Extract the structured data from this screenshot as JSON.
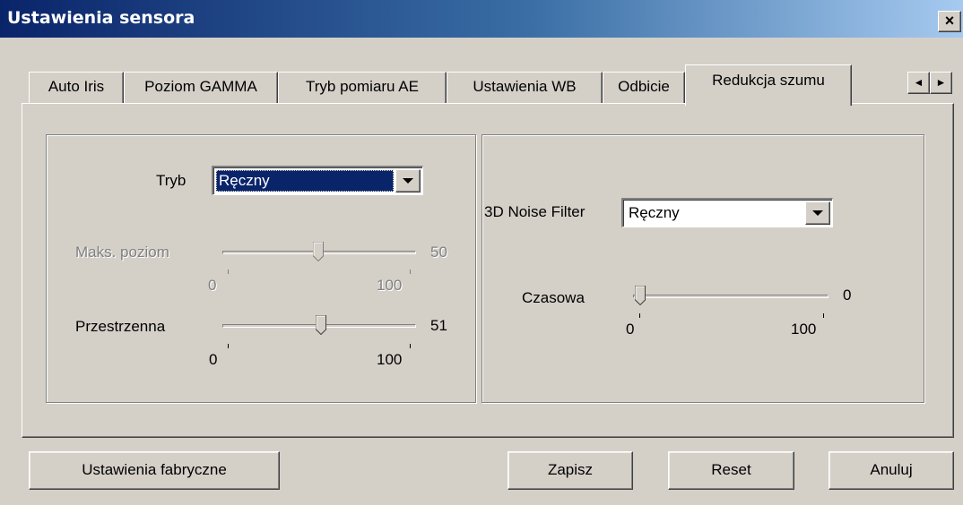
{
  "window": {
    "title": "Ustawienia sensora",
    "close_label": "×"
  },
  "tabs": [
    {
      "label": "Auto Iris"
    },
    {
      "label": "Poziom GAMMA"
    },
    {
      "label": "Tryb pomiaru AE"
    },
    {
      "label": "Ustawienia WB"
    },
    {
      "label": "Odbicie"
    },
    {
      "label": "Redukcja szumu",
      "active": true
    }
  ],
  "tab_scroll": {
    "left_icon": "◄",
    "right_icon": "►"
  },
  "left_group": {
    "mode_label": "Tryb",
    "mode_value": "Ręczny",
    "max_level": {
      "label": "Maks. poziom",
      "value": "50",
      "min": "0",
      "max": "100",
      "level": 50,
      "enabled": false
    },
    "spatial": {
      "label": "Przestrzenna",
      "value": "51",
      "min": "0",
      "max": "100",
      "level": 51,
      "enabled": true
    }
  },
  "right_group": {
    "filter_label": "3D Noise Filter",
    "filter_value": "Ręczny",
    "temporal": {
      "label": "Czasowa",
      "value": "0",
      "min": "0",
      "max": "100",
      "level": 0,
      "enabled": true
    }
  },
  "buttons": {
    "factory": "Ustawienia fabryczne",
    "save": "Zapisz",
    "reset": "Reset",
    "cancel": "Anuluj"
  }
}
